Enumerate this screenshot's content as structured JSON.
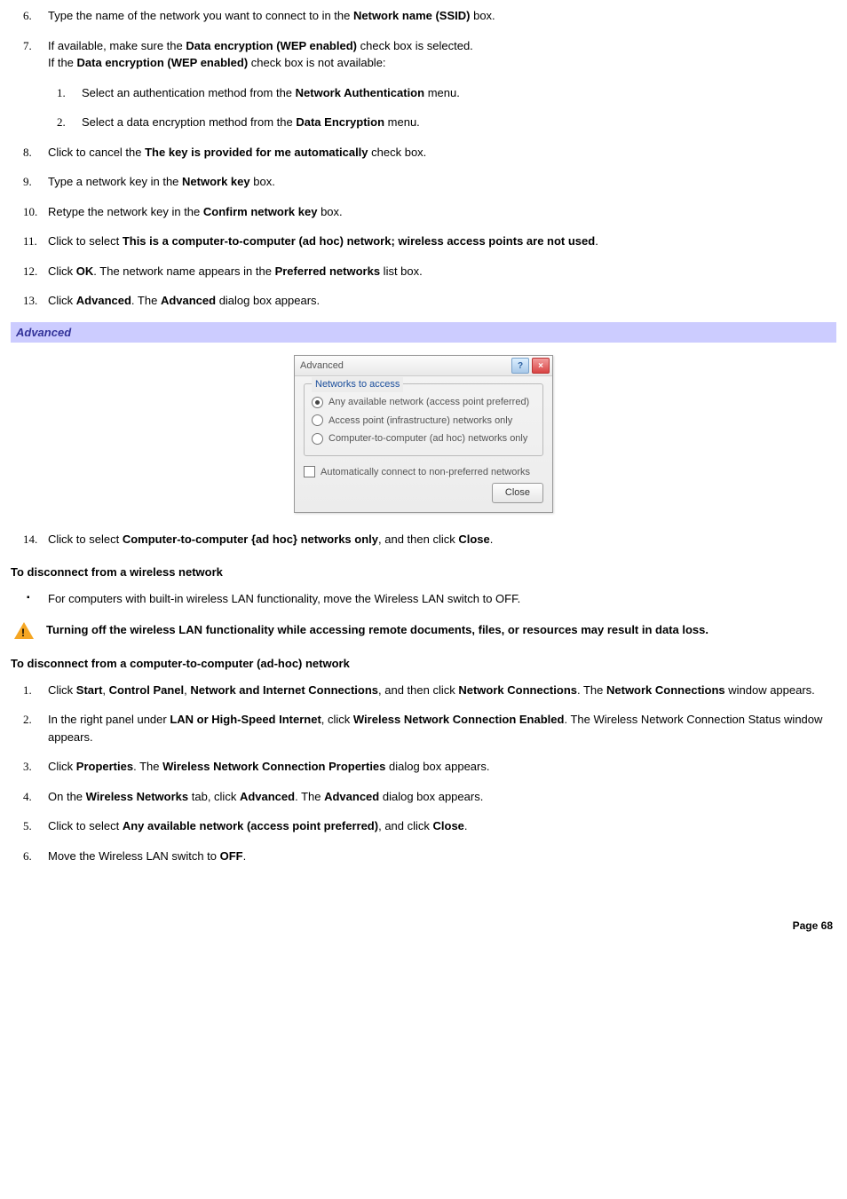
{
  "list1": {
    "start": 6,
    "items": [
      {
        "num": "6.",
        "segs": [
          {
            "t": "Type the name of the network you want to connect to in the "
          },
          {
            "t": "Network name (SSID)",
            "b": true
          },
          {
            "t": " box."
          }
        ]
      },
      {
        "num": "7.",
        "segs": [
          {
            "t": "If available, make sure the "
          },
          {
            "t": "Data encryption (WEP enabled)",
            "b": true
          },
          {
            "t": " check box is selected."
          },
          {
            "br": true
          },
          {
            "t": "If the "
          },
          {
            "t": "Data encryption (WEP enabled)",
            "b": true
          },
          {
            "t": " check box is not available:"
          }
        ],
        "sub": [
          {
            "num": "1.",
            "segs": [
              {
                "t": "Select an authentication method from the "
              },
              {
                "t": "Network Authentication",
                "b": true
              },
              {
                "t": " menu."
              }
            ]
          },
          {
            "num": "2.",
            "segs": [
              {
                "t": "Select a data encryption method from the "
              },
              {
                "t": "Data Encryption",
                "b": true
              },
              {
                "t": " menu."
              }
            ]
          }
        ]
      },
      {
        "num": "8.",
        "segs": [
          {
            "t": "Click to cancel the "
          },
          {
            "t": "The key is provided for me automatically",
            "b": true
          },
          {
            "t": " check box."
          }
        ]
      },
      {
        "num": "9.",
        "segs": [
          {
            "t": "Type a network key in the "
          },
          {
            "t": "Network key",
            "b": true
          },
          {
            "t": " box."
          }
        ]
      },
      {
        "num": "10.",
        "segs": [
          {
            "t": "Retype the network key in the "
          },
          {
            "t": "Confirm network key",
            "b": true
          },
          {
            "t": " box."
          }
        ]
      },
      {
        "num": "11.",
        "segs": [
          {
            "t": "Click to select "
          },
          {
            "t": "This is a computer-to-computer (ad hoc) network; wireless access points are not used",
            "b": true
          },
          {
            "t": "."
          }
        ]
      },
      {
        "num": "12.",
        "segs": [
          {
            "t": "Click "
          },
          {
            "t": "OK",
            "b": true
          },
          {
            "t": ". The network name appears in the "
          },
          {
            "t": "Preferred networks",
            "b": true
          },
          {
            "t": " list box."
          }
        ]
      },
      {
        "num": "13.",
        "segs": [
          {
            "t": "Click "
          },
          {
            "t": "Advanced",
            "b": true
          },
          {
            "t": ". The "
          },
          {
            "t": "Advanced",
            "b": true
          },
          {
            "t": " dialog box appears."
          }
        ]
      }
    ]
  },
  "section_bar": "Advanced",
  "dialog": {
    "title": "Advanced",
    "group_legend": "Networks to access",
    "radios": [
      {
        "label": "Any available network (access point preferred)",
        "selected": true
      },
      {
        "label": "Access point (infrastructure) networks only",
        "selected": false
      },
      {
        "label": "Computer-to-computer (ad hoc) networks only",
        "selected": false
      }
    ],
    "checkbox_label": "Automatically connect to non-preferred networks",
    "close_label": "Close"
  },
  "list1_cont": [
    {
      "num": "14.",
      "segs": [
        {
          "t": "Click to select "
        },
        {
          "t": "Computer-to-computer {ad hoc} networks only",
          "b": true
        },
        {
          "t": ", and then click "
        },
        {
          "t": "Close",
          "b": true
        },
        {
          "t": "."
        }
      ]
    }
  ],
  "heading_disconnect": "To disconnect from a wireless network",
  "bullet1": [
    {
      "segs": [
        {
          "t": "For computers with built-in wireless LAN functionality, move the Wireless LAN switch to OFF."
        }
      ]
    }
  ],
  "warning": "Turning off the wireless LAN functionality while accessing remote documents, files, or resources may result in data loss.",
  "heading_adhoc": "To disconnect from a computer-to-computer (ad-hoc) network",
  "list2": [
    {
      "num": "1.",
      "segs": [
        {
          "t": "Click "
        },
        {
          "t": "Start",
          "b": true
        },
        {
          "t": ", "
        },
        {
          "t": "Control Panel",
          "b": true
        },
        {
          "t": ", "
        },
        {
          "t": "Network and Internet Connections",
          "b": true
        },
        {
          "t": ", and then click "
        },
        {
          "t": "Network Connections",
          "b": true
        },
        {
          "t": ". The "
        },
        {
          "t": "Network Connections",
          "b": true
        },
        {
          "t": " window appears."
        }
      ]
    },
    {
      "num": "2.",
      "segs": [
        {
          "t": "In the right panel under "
        },
        {
          "t": "LAN or High-Speed Internet",
          "b": true
        },
        {
          "t": ", click "
        },
        {
          "t": "Wireless Network Connection Enabled",
          "b": true
        },
        {
          "t": ". The Wireless Network Connection Status window appears."
        }
      ]
    },
    {
      "num": "3.",
      "segs": [
        {
          "t": "Click "
        },
        {
          "t": "Properties",
          "b": true
        },
        {
          "t": ". The "
        },
        {
          "t": "Wireless Network Connection Properties",
          "b": true
        },
        {
          "t": " dialog box appears."
        }
      ]
    },
    {
      "num": "4.",
      "segs": [
        {
          "t": "On the "
        },
        {
          "t": "Wireless Networks",
          "b": true
        },
        {
          "t": " tab, click "
        },
        {
          "t": "Advanced",
          "b": true
        },
        {
          "t": ". The "
        },
        {
          "t": "Advanced",
          "b": true
        },
        {
          "t": " dialog box appears."
        }
      ]
    },
    {
      "num": "5.",
      "segs": [
        {
          "t": "Click to select "
        },
        {
          "t": "Any available network (access point preferred)",
          "b": true
        },
        {
          "t": ", and click "
        },
        {
          "t": "Close",
          "b": true
        },
        {
          "t": "."
        }
      ]
    },
    {
      "num": "6.",
      "segs": [
        {
          "t": "Move the Wireless LAN switch to "
        },
        {
          "t": "OFF",
          "b": true
        },
        {
          "t": "."
        }
      ]
    }
  ],
  "page_footer": "Page 68"
}
